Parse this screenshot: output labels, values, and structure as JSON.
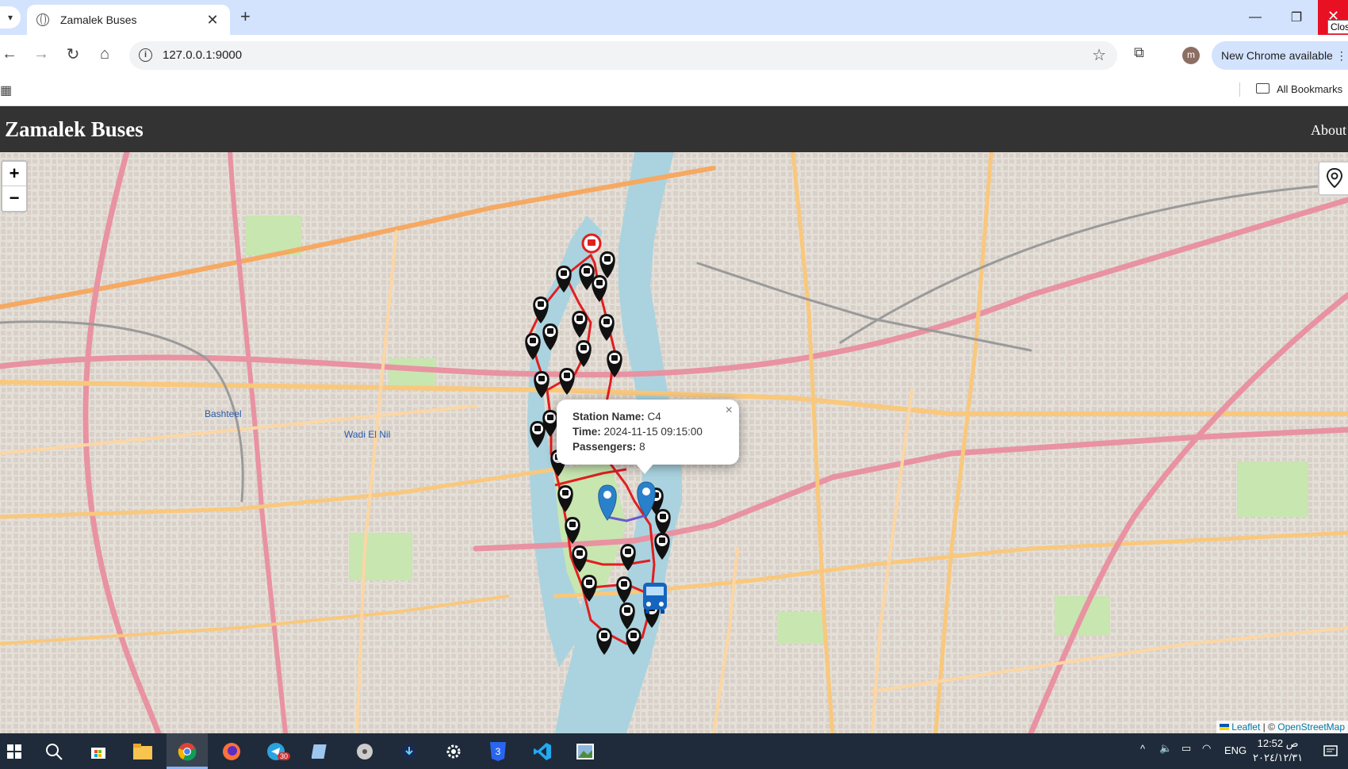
{
  "browser": {
    "tab_title": "Zamalek Buses",
    "tab_close_glyph": "✕",
    "new_tab_glyph": "+",
    "url": "127.0.0.1:9000",
    "update_label": "New Chrome available",
    "profile_initial": "m",
    "bookmarks_label": "All Bookmarks",
    "close_tooltip": "Clos"
  },
  "app": {
    "title": "Zamalek Buses",
    "nav_about": "About"
  },
  "map": {
    "zoom_in": "+",
    "zoom_out": "−",
    "attribution_leaflet": "Leaflet",
    "attribution_sep": " | © ",
    "attribution_osm": "OpenStreetMap",
    "popup": {
      "station_label": "Station Name:",
      "station_value": "C4",
      "time_label": "Time:",
      "time_value": "2024-11-15 09:15:00",
      "passengers_label": "Passengers:",
      "passengers_value": "8",
      "close_glyph": "×"
    },
    "labels": {
      "bashteel": "Bashteel",
      "wadi_el_nil": "Wadi El Nil"
    },
    "colors": {
      "route": "#e01f1f",
      "segment": "#6a5acd",
      "water": "#aad3df",
      "park": "#c8e6b0",
      "marker": "#111111",
      "pin": "#2a81cb"
    }
  },
  "taskbar": {
    "time": "12:52 ص",
    "date": "٢٠٢٤/١٢/٣١",
    "lang": "ENG",
    "telegram_badge": "30"
  }
}
